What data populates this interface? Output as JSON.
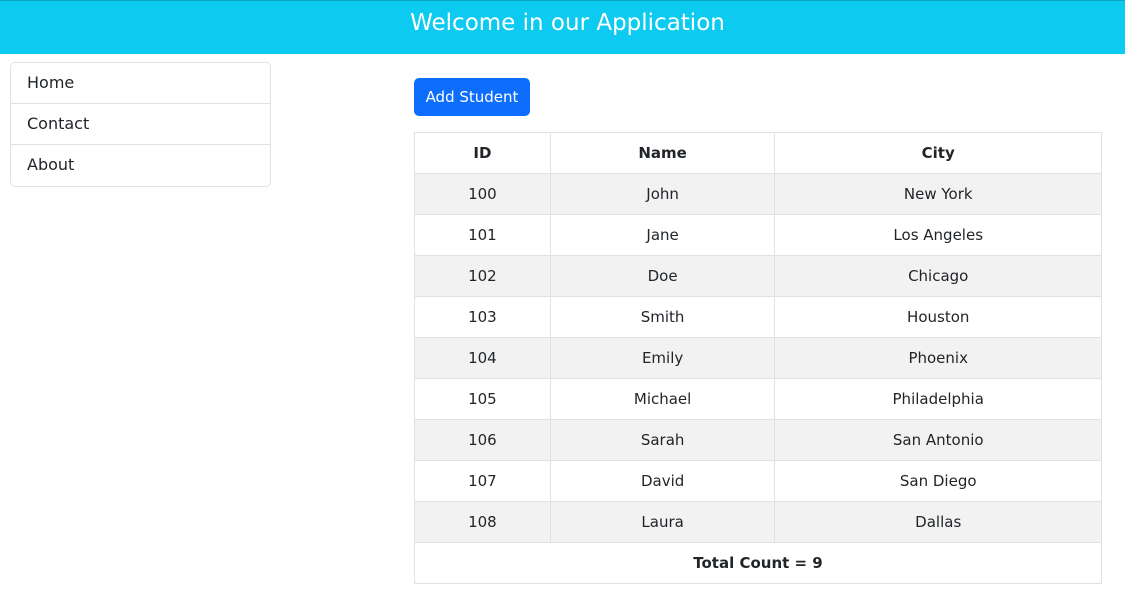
{
  "header": {
    "title": "Welcome in our Application",
    "color": "#0dcaf0"
  },
  "sidebar": {
    "items": [
      {
        "label": "Home"
      },
      {
        "label": "Contact"
      },
      {
        "label": "About"
      }
    ]
  },
  "actions": {
    "add_student_label": "Add Student",
    "accent_color": "#0d6efd"
  },
  "table": {
    "headers": {
      "id": "ID",
      "name": "Name",
      "city": "City"
    },
    "rows": [
      {
        "id": "100",
        "name": "John",
        "city": "New York"
      },
      {
        "id": "101",
        "name": "Jane",
        "city": "Los Angeles"
      },
      {
        "id": "102",
        "name": "Doe",
        "city": "Chicago"
      },
      {
        "id": "103",
        "name": "Smith",
        "city": "Houston"
      },
      {
        "id": "104",
        "name": "Emily",
        "city": "Phoenix"
      },
      {
        "id": "105",
        "name": "Michael",
        "city": "Philadelphia"
      },
      {
        "id": "106",
        "name": "Sarah",
        "city": "San Antonio"
      },
      {
        "id": "107",
        "name": "David",
        "city": "San Diego"
      },
      {
        "id": "108",
        "name": "Laura",
        "city": "Dallas"
      }
    ],
    "footer": "Total Count = 9"
  }
}
